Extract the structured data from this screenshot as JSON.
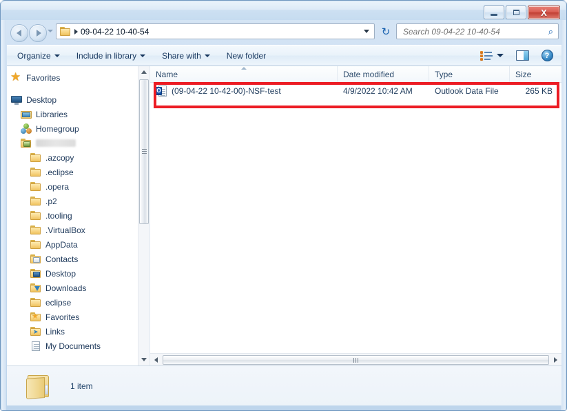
{
  "window": {
    "titlebar_buttons": [
      {
        "name": "minimize",
        "glyph": "minimize"
      },
      {
        "name": "maximize",
        "glyph": "maximize"
      },
      {
        "name": "close",
        "glyph": "X"
      }
    ]
  },
  "nav": {
    "back_label": "Back",
    "forward_label": "Forward",
    "history_label": "Recent pages",
    "breadcrumb": "09-04-22 10-40-54",
    "address_dropdown_label": "Previous locations",
    "refresh_glyph": "↻",
    "refresh_label": "Refresh"
  },
  "search": {
    "placeholder": "Search 09-04-22 10-40-54",
    "value": "",
    "icon_glyph": "⌕"
  },
  "toolbar": {
    "items": [
      {
        "label": "Organize",
        "has_caret": true
      },
      {
        "label": "Include in library",
        "has_caret": true
      },
      {
        "label": "Share with",
        "has_caret": true
      },
      {
        "label": "New folder",
        "has_caret": false
      }
    ],
    "views_label": "Change your view",
    "preview_pane_label": "Show the preview pane",
    "help_label": "Get help",
    "help_glyph": "?"
  },
  "sidebar": {
    "items": [
      {
        "label": "Favorites",
        "icon": "star-icon",
        "indent": 0,
        "redacted": false
      },
      {
        "spacer": true
      },
      {
        "label": "Desktop",
        "icon": "desktop-monitor-icon",
        "indent": 0,
        "redacted": false
      },
      {
        "label": "Libraries",
        "icon": "libraries-icon",
        "indent": 1,
        "redacted": false
      },
      {
        "label": "Homegroup",
        "icon": "homegroup-icon",
        "indent": 1,
        "redacted": false
      },
      {
        "label": "",
        "icon": "user-folder-icon",
        "indent": 1,
        "redacted": true
      },
      {
        "label": ".azcopy",
        "icon": "folder-icon",
        "indent": 2,
        "redacted": false
      },
      {
        "label": ".eclipse",
        "icon": "folder-icon",
        "indent": 2,
        "redacted": false
      },
      {
        "label": ".opera",
        "icon": "folder-icon",
        "indent": 2,
        "redacted": false
      },
      {
        "label": ".p2",
        "icon": "folder-icon",
        "indent": 2,
        "redacted": false
      },
      {
        "label": ".tooling",
        "icon": "folder-icon",
        "indent": 2,
        "redacted": false
      },
      {
        "label": ".VirtualBox",
        "icon": "folder-icon",
        "indent": 2,
        "redacted": false
      },
      {
        "label": "AppData",
        "icon": "folder-icon",
        "indent": 2,
        "redacted": false
      },
      {
        "label": "Contacts",
        "icon": "contacts-folder-icon",
        "indent": 2,
        "redacted": false
      },
      {
        "label": "Desktop",
        "icon": "desktop-folder-icon",
        "indent": 2,
        "redacted": false
      },
      {
        "label": "Downloads",
        "icon": "downloads-folder-icon",
        "indent": 2,
        "redacted": false
      },
      {
        "label": "eclipse",
        "icon": "folder-icon",
        "indent": 2,
        "redacted": false
      },
      {
        "label": "Favorites",
        "icon": "favorites-folder-icon",
        "indent": 2,
        "redacted": false
      },
      {
        "label": "Links",
        "icon": "links-folder-icon",
        "indent": 2,
        "redacted": false
      },
      {
        "label": "My Documents",
        "icon": "documents-icon",
        "indent": 2,
        "redacted": false
      }
    ]
  },
  "filelist": {
    "columns": [
      {
        "label": "Name",
        "sorted": true
      },
      {
        "label": "Date modified",
        "sorted": false
      },
      {
        "label": "Type",
        "sorted": false
      },
      {
        "label": "Size",
        "sorted": false
      }
    ],
    "rows": [
      {
        "name": "(09-04-22 10-42-00)-NSF-test",
        "date_modified": "4/9/2022 10:42 AM",
        "type": "Outlook Data File",
        "size": "265 KB",
        "icon": "outlook-data-file-icon",
        "icon_badge": "O",
        "highlighted": true
      }
    ]
  },
  "annotation": {
    "color": "#ec1c24",
    "target": "outlook-data-file-row"
  },
  "status": {
    "item_count_label": "1 item",
    "folder_icon": "open-folder-icon"
  }
}
